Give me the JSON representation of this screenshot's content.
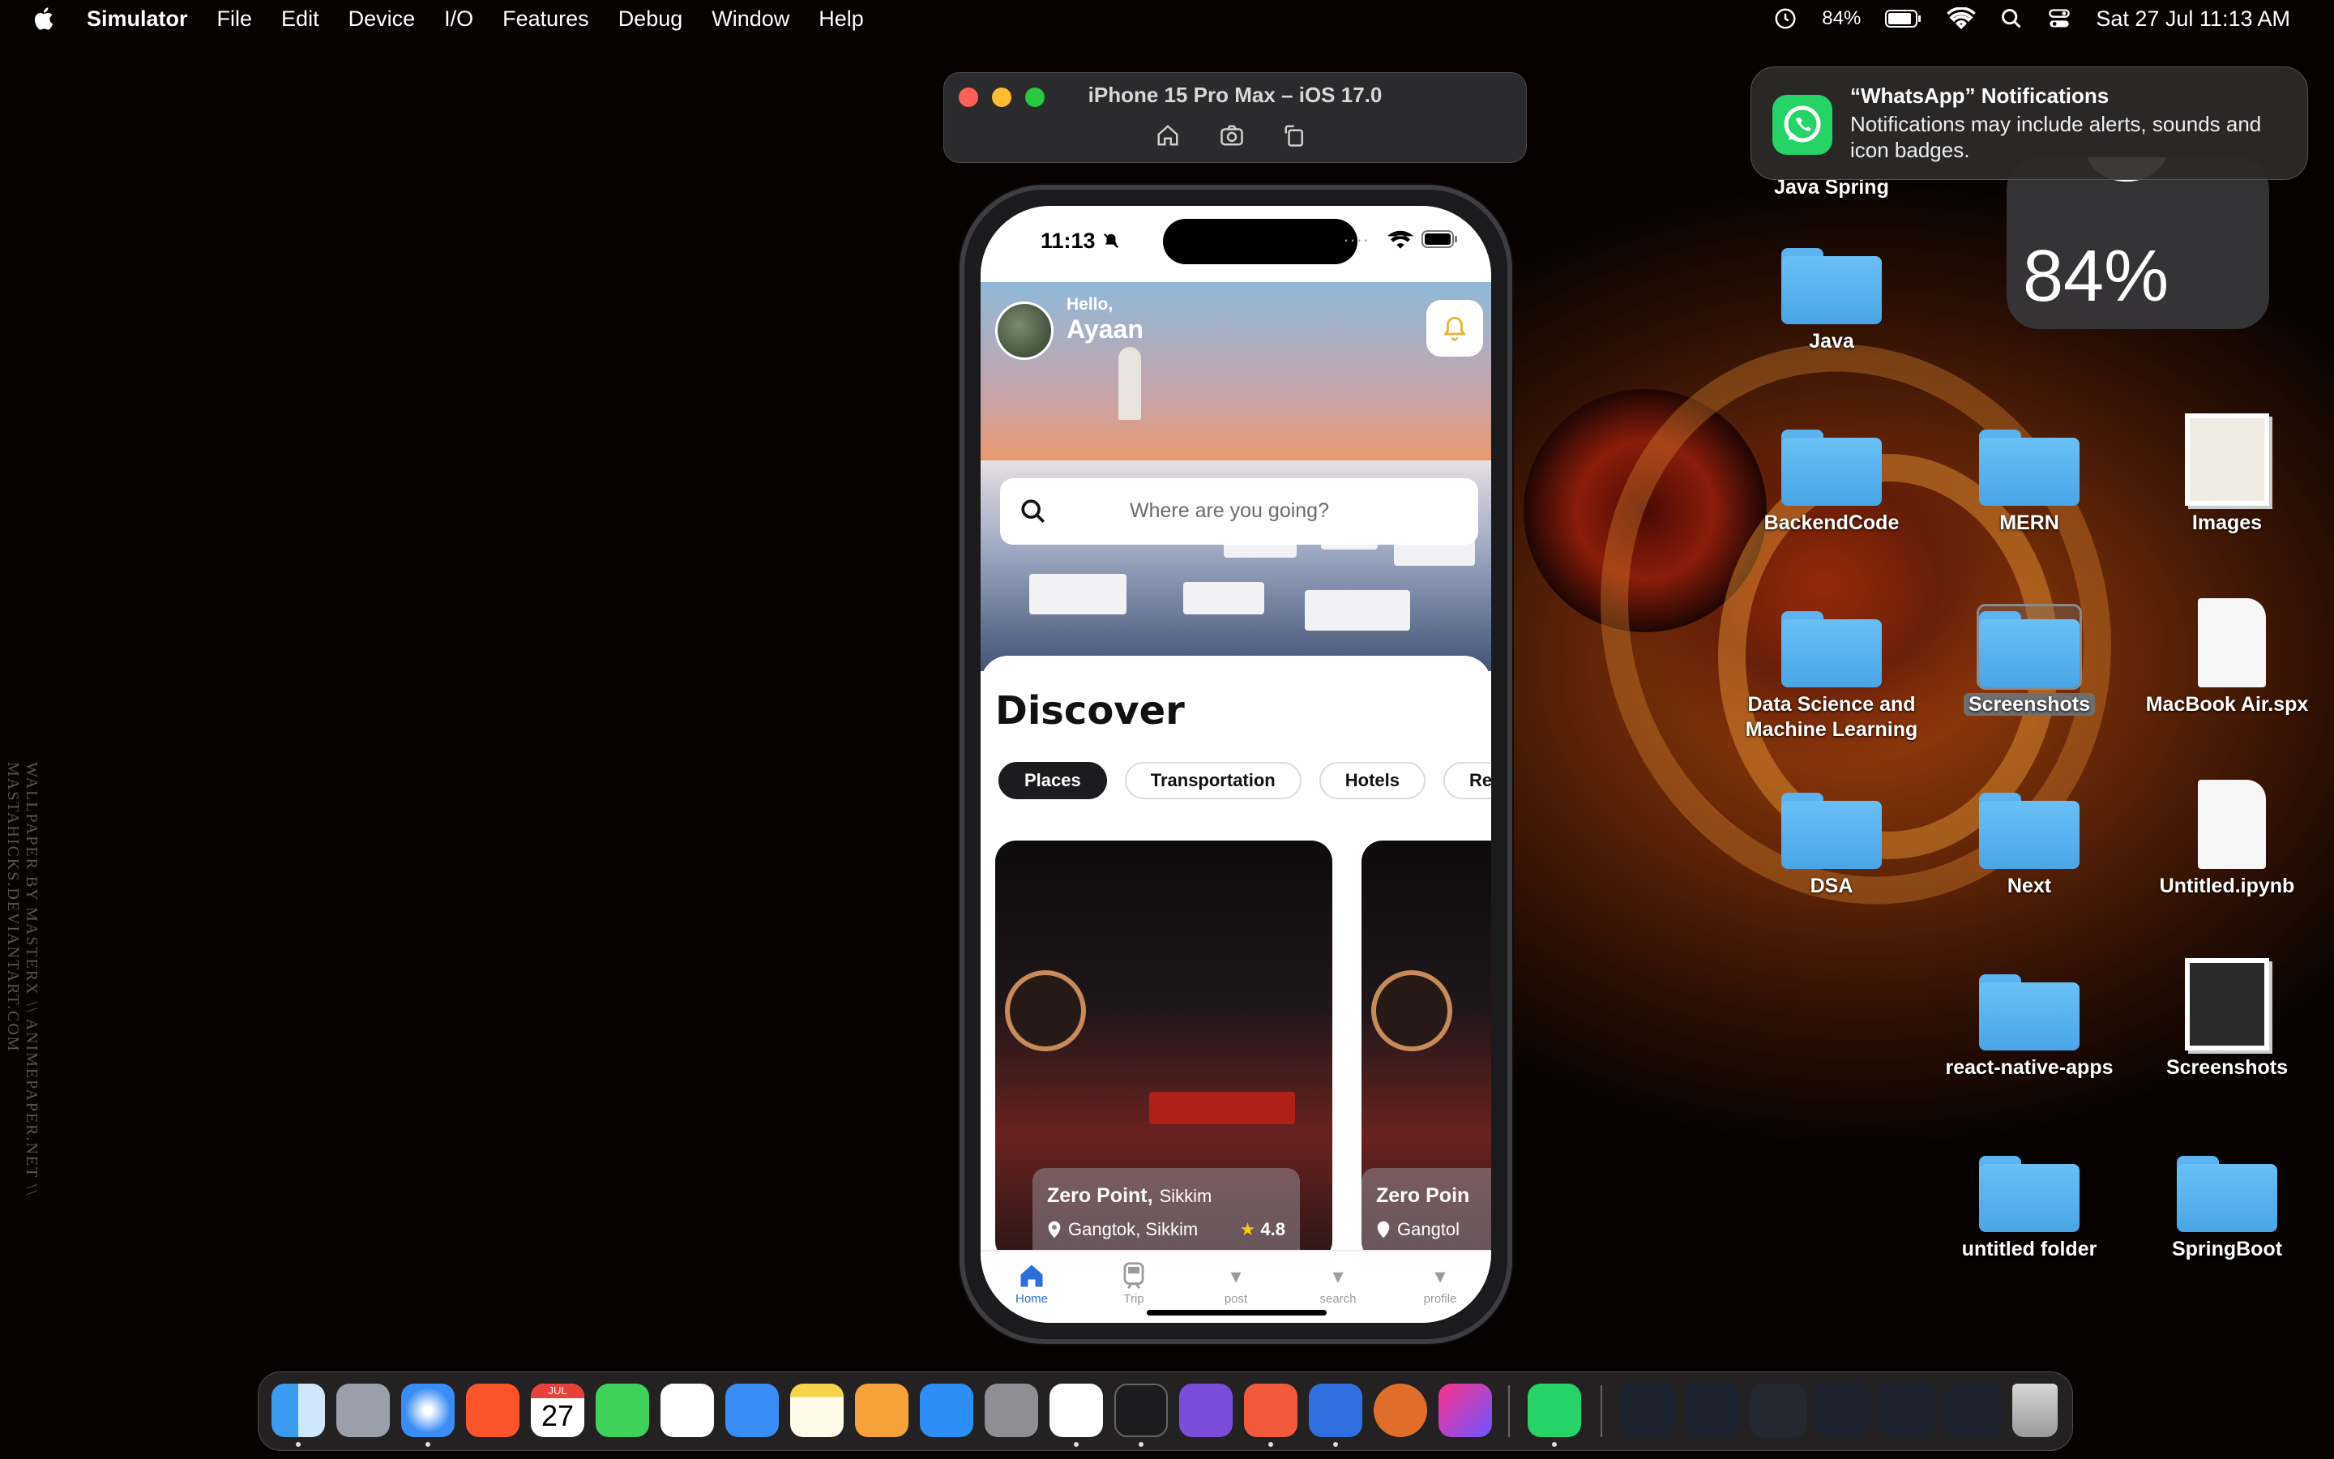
{
  "menubar": {
    "app_name": "Simulator",
    "menus": [
      "File",
      "Edit",
      "Device",
      "I/O",
      "Features",
      "Debug",
      "Window",
      "Help"
    ],
    "battery_percent": "84%",
    "datetime": "Sat 27 Jul  11:13 AM"
  },
  "simulator_window": {
    "title": "iPhone 15 Pro Max – iOS 17.0",
    "toolbar_icons": [
      "home-icon",
      "screenshot-icon",
      "rotate-icon"
    ]
  },
  "phone": {
    "status_time": "11:13",
    "greeting": "Hello,",
    "user_name": "Ayaan",
    "search_placeholder": "Where are you going?",
    "section_title": "Discover",
    "categories": [
      {
        "label": "Places",
        "active": true
      },
      {
        "label": "Transportation",
        "active": false
      },
      {
        "label": "Hotels",
        "active": false
      },
      {
        "label": "Res",
        "active": false
      }
    ],
    "cards": [
      {
        "title": "Zero Point,",
        "region": "Sikkim",
        "location": "Gangtok, Sikkim",
        "rating": "4.8"
      },
      {
        "title": "Zero Poin",
        "region": "",
        "location": "Gangtol",
        "rating": ""
      }
    ],
    "tabs": [
      {
        "label": "Home",
        "icon": "home-icon",
        "active": true
      },
      {
        "label": "Trip",
        "icon": "train-icon",
        "active": false
      },
      {
        "label": "post",
        "icon": "caret-icon",
        "active": false
      },
      {
        "label": "search",
        "icon": "caret-icon",
        "active": false
      },
      {
        "label": "profile",
        "icon": "caret-icon",
        "active": false
      }
    ]
  },
  "notification": {
    "title": "“WhatsApp” Notifications",
    "body": "Notifications may include alerts, sounds and icon badges."
  },
  "widget": {
    "battery": "84%"
  },
  "desktop": {
    "items": [
      {
        "label": "Java Spring"
      },
      {
        "label": "Java"
      },
      {
        "label": "BackendCode"
      },
      {
        "label": "MERN"
      },
      {
        "label": "Images"
      },
      {
        "label": "Data Science and Machine Learning"
      },
      {
        "label": "Screenshots"
      },
      {
        "label": "MacBook Air.spx"
      },
      {
        "label": "DSA"
      },
      {
        "label": "Next"
      },
      {
        "label": "Untitled.ipynb"
      },
      {
        "label": "react-native-apps"
      },
      {
        "label": "Screenshots"
      },
      {
        "label": "untitled folder"
      },
      {
        "label": "SpringBoot"
      }
    ]
  },
  "wallpaper_credit": "WALLPAPER BY MASTERX \\\\ ANIMEPAPER.NET \\\\ MASTAHICKS.DEVIANTART.COM",
  "dock": {
    "calendar_month": "JUL",
    "calendar_day": "27",
    "apps": [
      "finder-icon",
      "launchpad-icon",
      "safari-icon",
      "brave-icon",
      "calendar-icon",
      "facetime-icon",
      "reminders-icon",
      "mail-icon",
      "notes-icon",
      "pages-icon",
      "appstore-icon",
      "settings-icon",
      "vscode-icon",
      "terminal-icon",
      "github-icon",
      "pen-icon",
      "xcode-icon",
      "bolt-icon",
      "intellij-icon",
      "whatsapp-icon"
    ]
  },
  "colors": {
    "accent_blue": "#2a6fdb",
    "whatsapp_green": "#25d366",
    "folder_blue": "#5cb3ef"
  }
}
